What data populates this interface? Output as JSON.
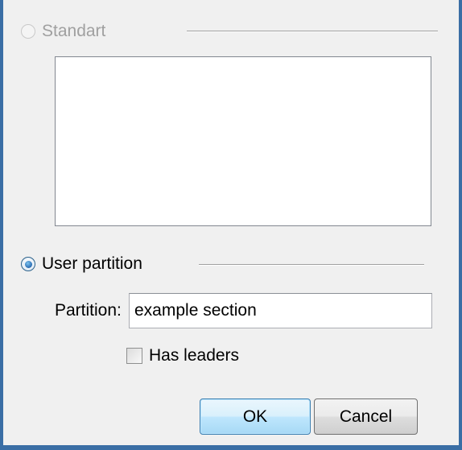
{
  "options": {
    "standard": {
      "label": "Standart",
      "checked": false,
      "enabled": false
    },
    "user_partition": {
      "label": "User partition",
      "checked": true,
      "enabled": true
    }
  },
  "partition": {
    "label": "Partition:",
    "value": "example section"
  },
  "has_leaders": {
    "label": "Has leaders",
    "checked": false
  },
  "buttons": {
    "ok_label": "OK",
    "cancel_label": "Cancel"
  },
  "colors": {
    "dialog_bg": "#f0f0f0",
    "window_frame": "#3a6ea5",
    "default_button_border": "#3c7fb1"
  }
}
